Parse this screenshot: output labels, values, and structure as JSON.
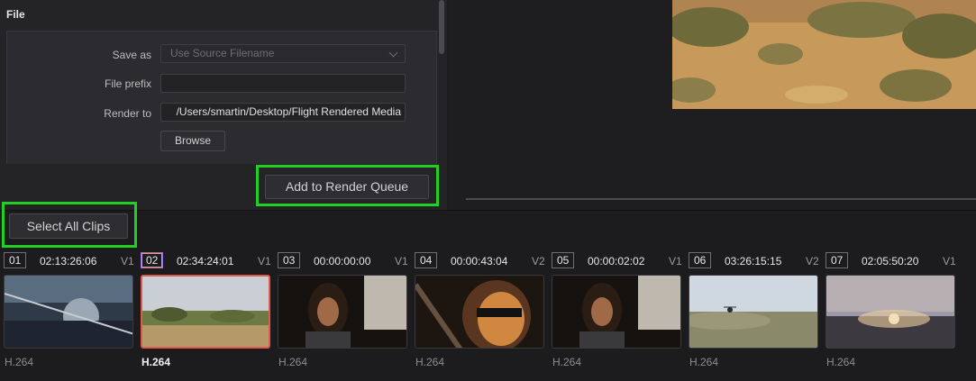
{
  "file_section": {
    "title": "File",
    "save_as": {
      "label": "Save as",
      "placeholder": "Use Source Filename"
    },
    "file_prefix": {
      "label": "File prefix",
      "value": ""
    },
    "render_to": {
      "label": "Render to",
      "value": "/Users/smartin/Desktop/Flight Rendered Media"
    },
    "browse_label": "Browse"
  },
  "add_to_queue_label": "Add to Render Queue",
  "select_all_label": "Select All Clips",
  "highlight_color": "#22d024",
  "clips": [
    {
      "num": "01",
      "timecode": "02:13:26:06",
      "track": "V1",
      "codec": "H.264",
      "selected": false,
      "thumb": "helicopter-cockpit"
    },
    {
      "num": "02",
      "timecode": "02:34:24:01",
      "track": "V1",
      "codec": "H.264",
      "selected": true,
      "thumb": "desert-airfield"
    },
    {
      "num": "03",
      "timecode": "00:00:00:00",
      "track": "V1",
      "codec": "H.264",
      "selected": false,
      "thumb": "pilot-portrait"
    },
    {
      "num": "04",
      "timecode": "00:00:43:04",
      "track": "V2",
      "codec": "H.264",
      "selected": false,
      "thumb": "pilot-sunglasses"
    },
    {
      "num": "05",
      "timecode": "00:00:02:02",
      "track": "V1",
      "codec": "H.264",
      "selected": false,
      "thumb": "pilot-portrait"
    },
    {
      "num": "06",
      "timecode": "03:26:15:15",
      "track": "V2",
      "codec": "H.264",
      "selected": false,
      "thumb": "desert-helicopter"
    },
    {
      "num": "07",
      "timecode": "02:05:50:20",
      "track": "V1",
      "codec": "H.264",
      "selected": false,
      "thumb": "desert-sunset"
    }
  ]
}
